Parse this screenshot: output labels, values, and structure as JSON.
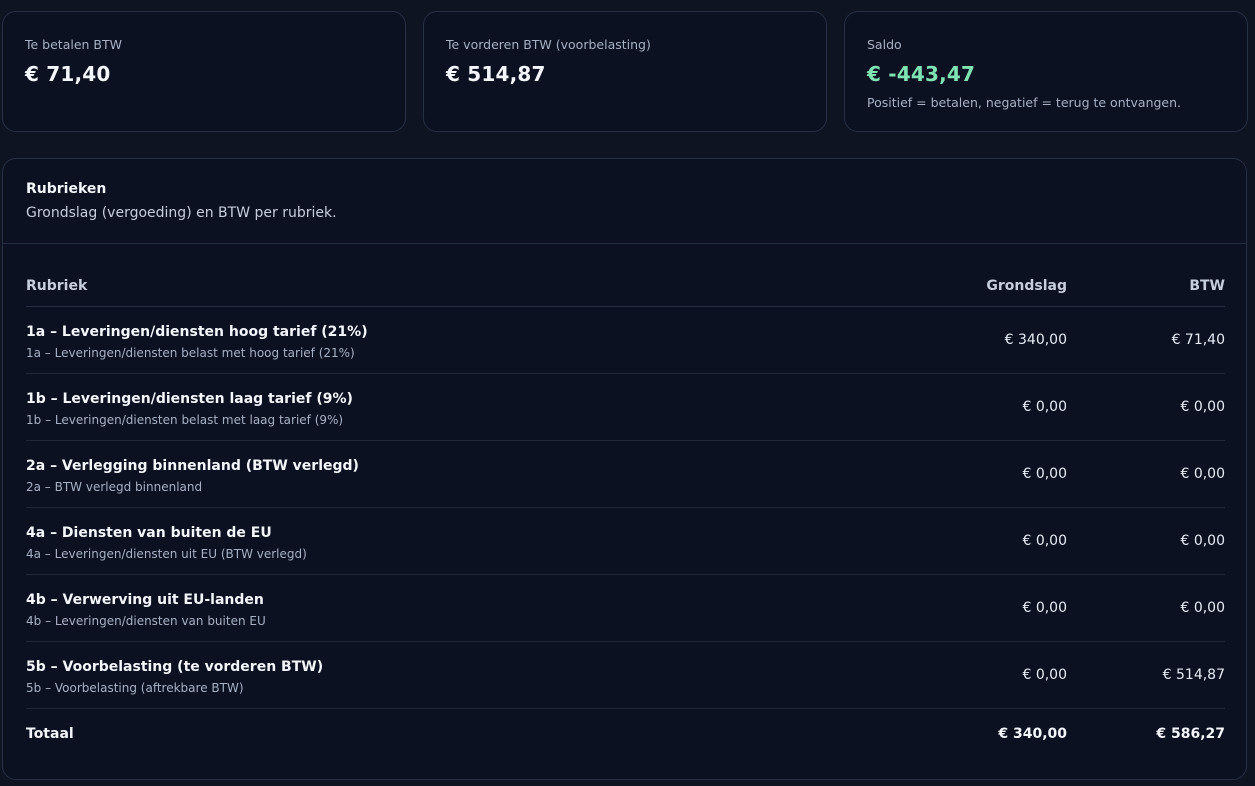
{
  "stats": [
    {
      "label": "Te betalen BTW",
      "value": "€ 71,40",
      "note": ""
    },
    {
      "label": "Te vorderen BTW (voorbelasting)",
      "value": "€ 514,87",
      "note": ""
    },
    {
      "label": "Saldo",
      "value": "€ -443,47",
      "note": "Positief = betalen, negatief = terug te ontvangen.",
      "value_color": "#7fe3b3"
    }
  ],
  "rubrieken": {
    "title": "Rubrieken",
    "subtitle": "Grondslag (vergoeding) en BTW per rubriek.",
    "columns": {
      "rubriek": "Rubriek",
      "grondslag": "Grondslag",
      "btw": "BTW"
    },
    "rows": [
      {
        "name": "1a – Leveringen/diensten hoog tarief (21%)",
        "desc": "1a – Leveringen/diensten belast met hoog tarief (21%)",
        "grondslag": "€ 340,00",
        "btw": "€ 71,40"
      },
      {
        "name": "1b – Leveringen/diensten laag tarief (9%)",
        "desc": "1b – Leveringen/diensten belast met laag tarief (9%)",
        "grondslag": "€ 0,00",
        "btw": "€ 0,00"
      },
      {
        "name": "2a – Verlegging binnenland (BTW verlegd)",
        "desc": "2a – BTW verlegd binnenland",
        "grondslag": "€ 0,00",
        "btw": "€ 0,00"
      },
      {
        "name": "4a – Diensten van buiten de EU",
        "desc": "4a – Leveringen/diensten uit EU (BTW verlegd)",
        "grondslag": "€ 0,00",
        "btw": "€ 0,00"
      },
      {
        "name": "4b – Verwerving uit EU-landen",
        "desc": "4b – Leveringen/diensten van buiten EU",
        "grondslag": "€ 0,00",
        "btw": "€ 0,00"
      },
      {
        "name": "5b – Voorbelasting (te vorderen BTW)",
        "desc": "5b – Voorbelasting (aftrekbare BTW)",
        "grondslag": "€ 0,00",
        "btw": "€ 514,87"
      }
    ],
    "total": {
      "label": "Totaal",
      "grondslag": "€ 340,00",
      "btw": "€ 586,27"
    }
  }
}
